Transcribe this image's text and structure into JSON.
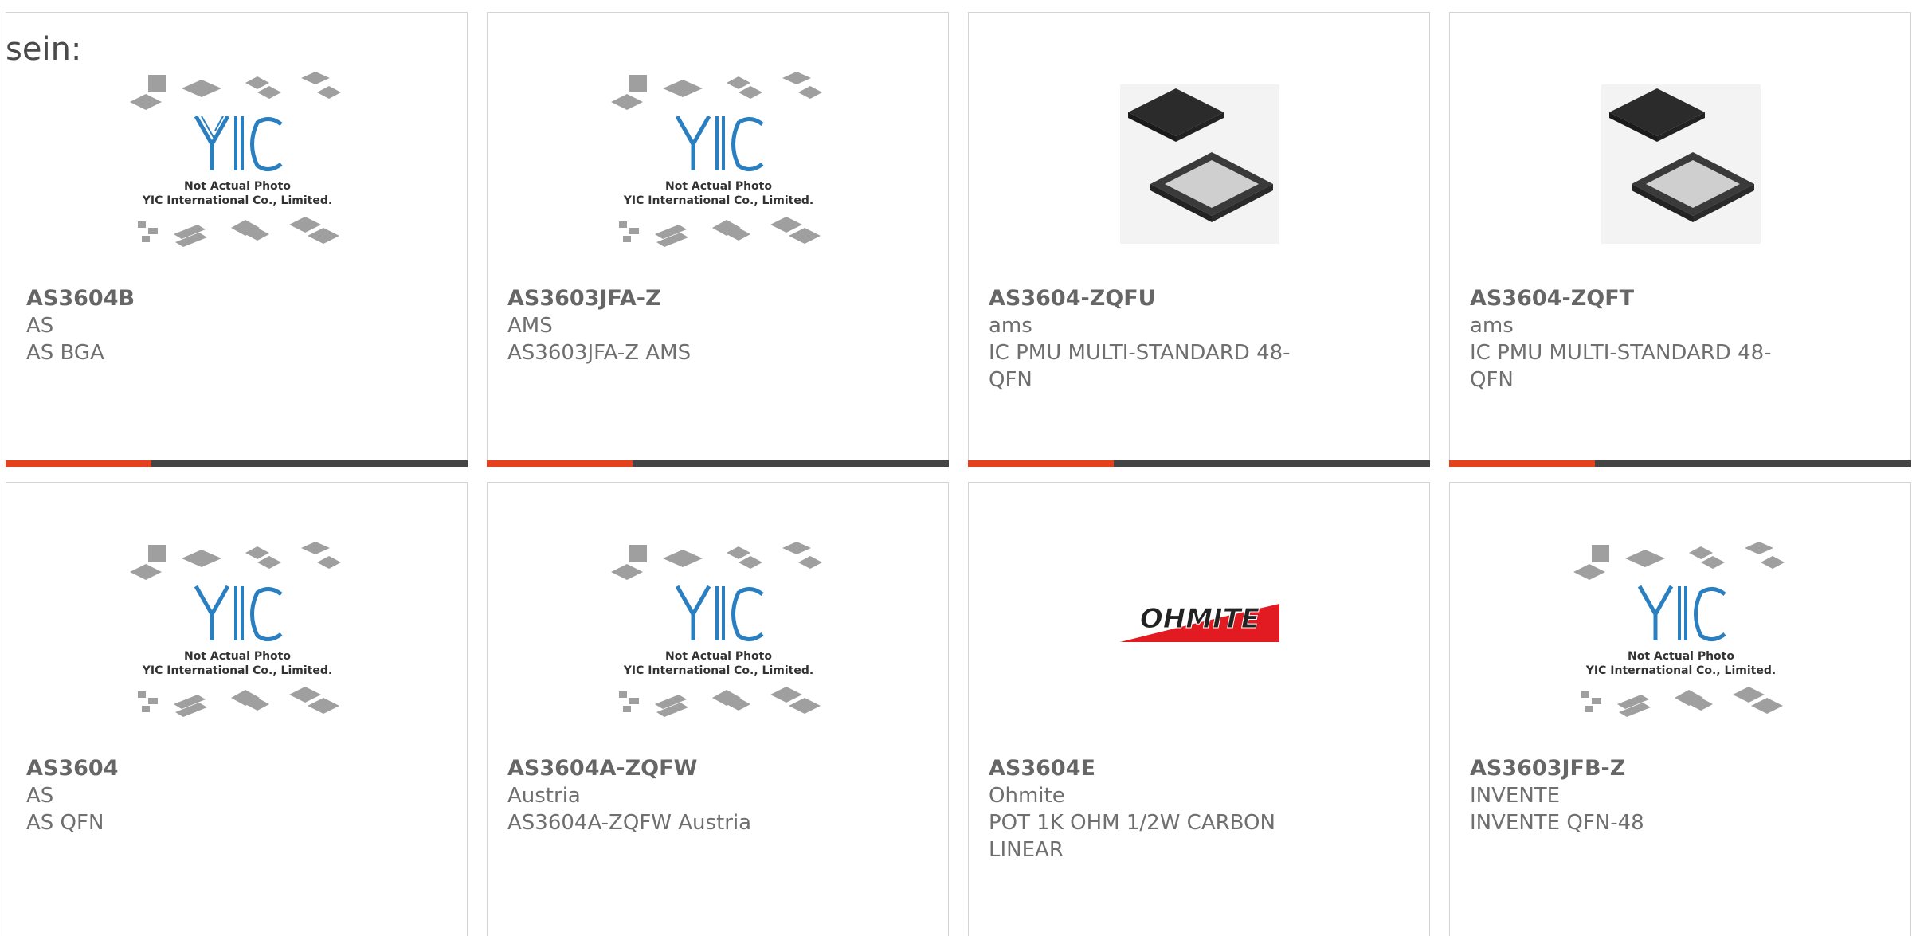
{
  "intro_text": "sein:",
  "colors": {
    "accent": "#e6411d",
    "bar_dark": "#444444",
    "logo_blue": "#2a7fc1",
    "ohmite_red": "#e21b22"
  },
  "placeholder": {
    "logo": "YIC",
    "line1": "Not Actual Photo",
    "line2": "YIC International Co., Limited."
  },
  "ohmite_logo_text": "OHMITE",
  "products": [
    {
      "part": "AS3604B",
      "maker": "AS",
      "desc": "AS BGA",
      "image": "placeholder"
    },
    {
      "part": "AS3603JFA-Z",
      "maker": "AMS",
      "desc": "AS3603JFA-Z AMS",
      "image": "placeholder"
    },
    {
      "part": "AS3604-ZQFU",
      "maker": "ams",
      "desc": "IC PMU MULTI-STANDARD 48-QFN",
      "image": "qfn-chip"
    },
    {
      "part": "AS3604-ZQFT",
      "maker": "ams",
      "desc": "IC PMU MULTI-STANDARD 48-QFN",
      "image": "qfn-chip"
    },
    {
      "part": "AS3604",
      "maker": "AS",
      "desc": "AS QFN",
      "image": "placeholder"
    },
    {
      "part": "AS3604A-ZQFW",
      "maker": "Austria",
      "desc": "AS3604A-ZQFW Austria",
      "image": "placeholder"
    },
    {
      "part": "AS3604E",
      "maker": "Ohmite",
      "desc": "POT 1K OHM 1/2W CARBON LINEAR",
      "image": "ohmite-logo"
    },
    {
      "part": "AS3603JFB-Z",
      "maker": "INVENTE",
      "desc": "INVENTE QFN-48",
      "image": "placeholder"
    }
  ]
}
